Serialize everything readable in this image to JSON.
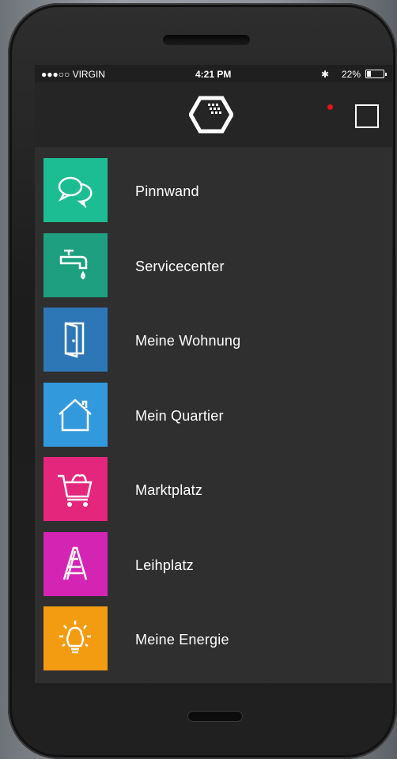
{
  "status_bar": {
    "carrier": "●●●○○ VIRGIN",
    "time": "4:21 PM",
    "bluetooth": "✱",
    "battery": "22%"
  },
  "navbar": {
    "logo_icon": "building-cube-logo",
    "menu_icon": "square-menu-icon",
    "notification_color": "#e0141e"
  },
  "menu": {
    "items": [
      {
        "label": "Pinnwand",
        "icon": "chat-bubbles-icon",
        "color": "#1dbd94"
      },
      {
        "label": "Servicecenter",
        "icon": "faucet-icon",
        "color": "#1e9f80"
      },
      {
        "label": "Meine Wohnung",
        "icon": "door-icon",
        "color": "#2e77b7"
      },
      {
        "label": "Mein Quartier",
        "icon": "house-icon",
        "color": "#3399dd"
      },
      {
        "label": "Marktplatz",
        "icon": "shopping-cart-icon",
        "color": "#e4267d"
      },
      {
        "label": "Leihplatz",
        "icon": "ladder-icon",
        "color": "#d424b4"
      },
      {
        "label": "Meine Energie",
        "icon": "lightbulb-icon",
        "color": "#f39c12"
      }
    ]
  }
}
